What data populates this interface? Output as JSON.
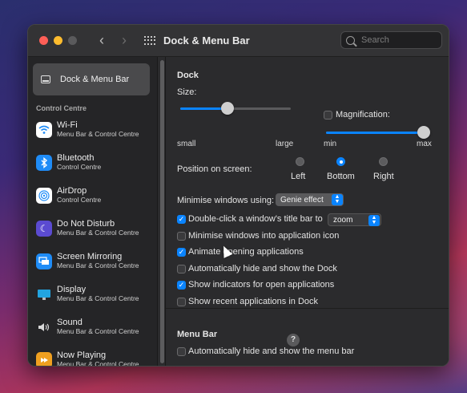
{
  "window": {
    "title": "Dock & Menu Bar"
  },
  "search": {
    "placeholder": "Search"
  },
  "sidebar": {
    "selected": {
      "label": "Dock & Menu Bar"
    },
    "section_label": "Control Centre",
    "items": [
      {
        "title": "Wi-Fi",
        "subtitle": "Menu Bar & Control Centre",
        "icon": "wifi-icon",
        "color": "#1f8cf7"
      },
      {
        "title": "Bluetooth",
        "subtitle": "Control Centre",
        "icon": "bluetooth-icon",
        "color": "#1f8cf7"
      },
      {
        "title": "AirDrop",
        "subtitle": "Control Centre",
        "icon": "airdrop-icon",
        "color": "#1f8cf7"
      },
      {
        "title": "Do Not Disturb",
        "subtitle": "Menu Bar & Control Centre",
        "icon": "moon-icon",
        "color": "#5b4bd1"
      },
      {
        "title": "Screen Mirroring",
        "subtitle": "Menu Bar & Control Centre",
        "icon": "screen-mirroring-icon",
        "color": "#1f8cf7"
      },
      {
        "title": "Display",
        "subtitle": "Menu Bar & Control Centre",
        "icon": "display-icon",
        "color": "#22a4e0"
      },
      {
        "title": "Sound",
        "subtitle": "Menu Bar & Control Centre",
        "icon": "speaker-icon",
        "color": "#3a3a3c"
      },
      {
        "title": "Now Playing",
        "subtitle": "Menu Bar & Control Centre",
        "icon": "now-playing-icon",
        "color": "#f0a020"
      }
    ]
  },
  "dock": {
    "heading": "Dock",
    "size_label": "Size:",
    "size_min": "small",
    "size_max": "large",
    "size_value": 0.43,
    "magnification_label": "Magnification:",
    "magnification_checked": false,
    "mag_min": "min",
    "mag_max": "max",
    "mag_value": 1.0,
    "position_label": "Position on screen:",
    "positions": [
      "Left",
      "Bottom",
      "Right"
    ],
    "position_selected": "Bottom",
    "minimise_label": "Minimise windows using:",
    "minimise_value": "Genie effect",
    "double_click_label": "Double-click a window's title bar to",
    "double_click_checked": true,
    "double_click_value": "zoom",
    "options": [
      {
        "label": "Minimise windows into application icon",
        "checked": false
      },
      {
        "label": "Animate opening applications",
        "checked": true
      },
      {
        "label": "Automatically hide and show the Dock",
        "checked": false
      },
      {
        "label": "Show indicators for open applications",
        "checked": true
      },
      {
        "label": "Show recent applications in Dock",
        "checked": false
      }
    ]
  },
  "menubar": {
    "heading": "Menu Bar",
    "auto_hide_label": "Automatically hide and show the menu bar",
    "auto_hide_checked": false
  },
  "help": "?"
}
